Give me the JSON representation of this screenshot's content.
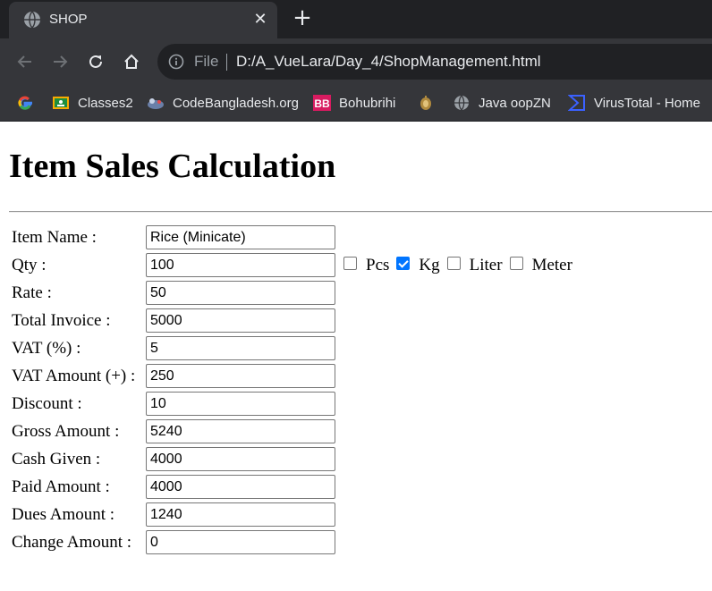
{
  "browser": {
    "tab": {
      "title": "SHOP",
      "favicon": "globe-icon",
      "close": "✕"
    },
    "new_tab": "+",
    "address": {
      "scheme": "File",
      "url": "D:/A_VueLara/Day_4/ShopManagement.html"
    },
    "bookmarks": [
      {
        "label": "",
        "icon": "google-icon"
      },
      {
        "label": "Classes2",
        "icon": "classroom-icon"
      },
      {
        "label": "CodeBangladesh.org",
        "icon": "codebangladesh-icon"
      },
      {
        "label": "Bohubrihi",
        "icon": "bohubrihi-icon"
      },
      {
        "label": "",
        "icon": "emblem-icon"
      },
      {
        "label": "Java oopZN",
        "icon": "globe-icon"
      },
      {
        "label": "VirusTotal - Home",
        "icon": "virustotal-icon"
      }
    ]
  },
  "page": {
    "title": "Item Sales Calculation",
    "fields": [
      {
        "label": "Item Name :",
        "value": "Rice (Minicate)"
      },
      {
        "label": "Qty :",
        "value": "100"
      },
      {
        "label": "Rate :",
        "value": "50"
      },
      {
        "label": "Total Invoice :",
        "value": "5000"
      },
      {
        "label": "VAT (%) :",
        "value": "5"
      },
      {
        "label": "VAT Amount (+) :",
        "value": "250"
      },
      {
        "label": "Discount :",
        "value": "10"
      },
      {
        "label": "Gross Amount :",
        "value": "5240"
      },
      {
        "label": "Cash Given :",
        "value": "4000"
      },
      {
        "label": "Paid Amount :",
        "value": "4000"
      },
      {
        "label": "Dues Amount :",
        "value": "1240"
      },
      {
        "label": "Change Amount :",
        "value": "0"
      }
    ],
    "units": [
      {
        "label": "Pcs",
        "checked": false
      },
      {
        "label": "Kg",
        "checked": true
      },
      {
        "label": "Liter",
        "checked": false
      },
      {
        "label": "Meter",
        "checked": false
      }
    ]
  },
  "colors": {
    "tabstrip": "#202124",
    "toolbar": "#35363a",
    "checkbox_accent": "#0075ff"
  }
}
